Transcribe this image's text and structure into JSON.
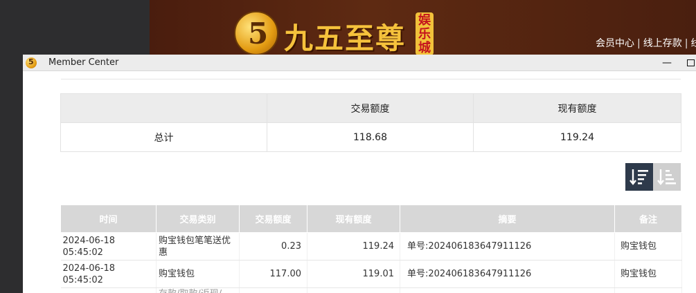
{
  "background": {
    "logo_glyph": "5",
    "logo_text": "九五至尊",
    "logo_badge": "娱乐城",
    "top_links": [
      "会员中心",
      "线上存款",
      "线"
    ]
  },
  "window": {
    "title": "Member Center",
    "minimize_glyph": "—"
  },
  "summary": {
    "headers": [
      "",
      "交易额度",
      "现有额度"
    ],
    "row_label": "总计",
    "trade_amount": "118.68",
    "current_amount": "119.24"
  },
  "detail": {
    "headers": [
      "时间",
      "交易类别",
      "交易额度",
      "现有额度",
      "摘要",
      "备注"
    ],
    "rows": [
      {
        "time": "2024-06-18 05:45:02",
        "type": "购宝钱包笔笔送优惠",
        "trade": "0.23",
        "current": "119.24",
        "summary": "单号:202406183647911126",
        "note": "购宝钱包"
      },
      {
        "time": "2024-06-18 05:45:02",
        "type": "购宝钱包",
        "trade": "117.00",
        "current": "119.01",
        "summary": "单号:202406183647911126",
        "note": "购宝钱包"
      }
    ],
    "partial_row_type": "存款/取款/返现/"
  },
  "colors": {
    "accent_dark": "#2e3a4b",
    "header_gray": "#d7d7d7",
    "banner_brown": "#5e2a12",
    "logo_gold": "#f6c23c"
  },
  "icons": {
    "sort_desc": "sort-descending-icon",
    "sort_asc": "sort-ascending-icon"
  }
}
